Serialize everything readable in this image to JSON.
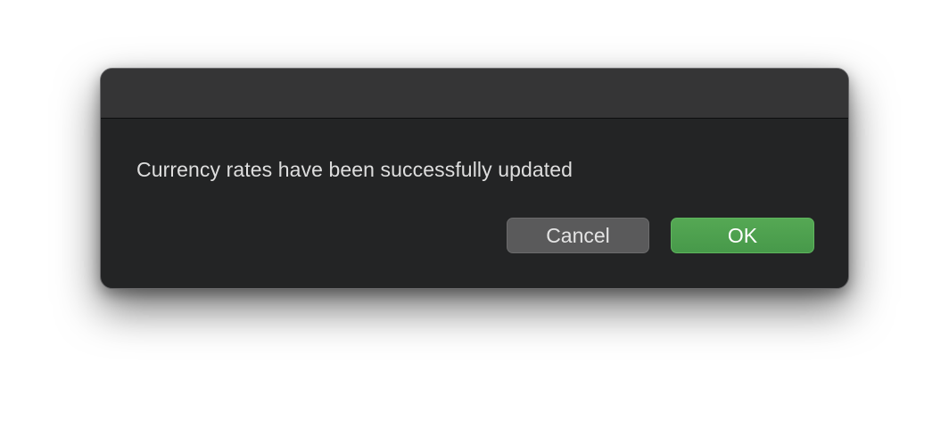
{
  "dialog": {
    "message": "Currency rates have been successfully updated",
    "buttons": {
      "cancel_label": "Cancel",
      "ok_label": "OK"
    }
  },
  "colors": {
    "dialog_background": "#232425",
    "titlebar_background": "#353536",
    "cancel_button": "#5a5a5b",
    "ok_button_accent": "#4ea24f",
    "text": "#dedede"
  }
}
